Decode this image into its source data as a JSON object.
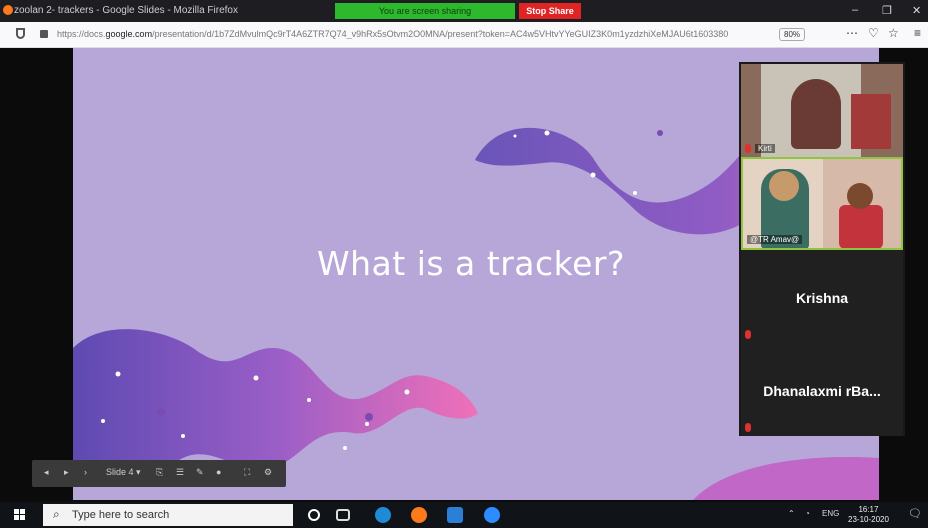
{
  "browser": {
    "window_title": "zoolan 2- trackers - Google Slides - Mozilla Firefox",
    "url_prefix": "https://docs.",
    "url_domain": "google.com",
    "url_rest": "/presentation/d/1b7ZdMvulmQc9rT4A6ZTR7Q74_v9hRx5sOtvm2O0MNA/present?token=AC4w5VHtvYYeGUIZ3K0m1yzdzhiXeMJAU6t1603380",
    "zoom": "80%",
    "window_controls": {
      "minimize": "–",
      "maximize": "❐",
      "close": "✕"
    }
  },
  "zoom_banner": {
    "sharing_text": "You are screen sharing",
    "stop_label": "Stop Share"
  },
  "slide": {
    "title": "What is a tracker?",
    "background_color": "#b7a6d8"
  },
  "slide_controls": {
    "slide_label": "Slide 4"
  },
  "participants": [
    {
      "name": "Kirti",
      "has_video": true,
      "muted": true
    },
    {
      "name": "@TR Amav@",
      "has_video": true,
      "muted": false,
      "active": true
    },
    {
      "name": "Krishna",
      "has_video": false,
      "muted": true
    },
    {
      "name": "Dhanalaxmi rBa...",
      "has_video": false,
      "muted": true
    }
  ],
  "taskbar": {
    "search_placeholder": "Type here to search",
    "language": "ENG",
    "time": "16:17",
    "date": "23-10-2020"
  }
}
